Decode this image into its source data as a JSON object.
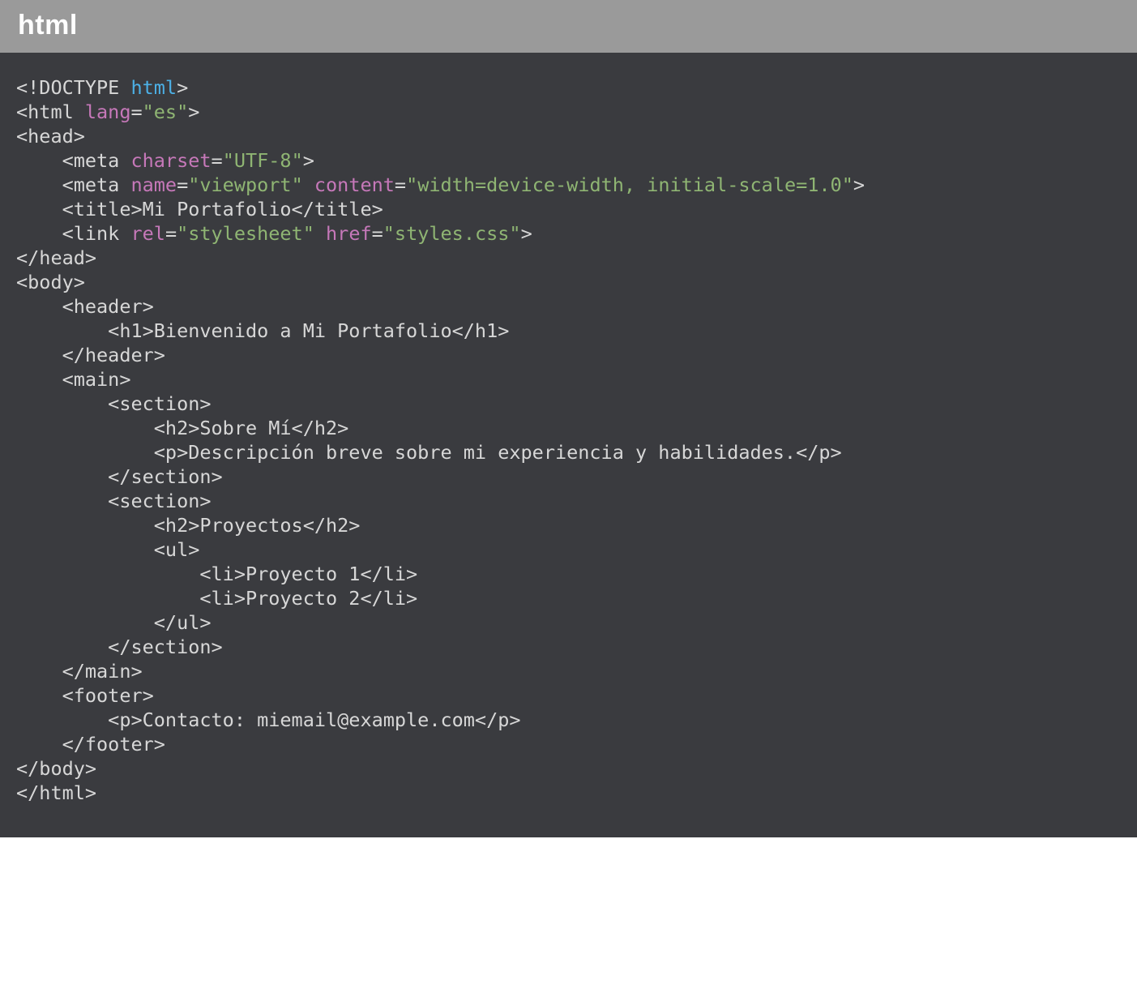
{
  "header": {
    "title": "html"
  },
  "tokens": {
    "l1_a": "<!DOCTYPE ",
    "l1_b": "html",
    "l1_c": ">",
    "l2_a": "<html ",
    "l2_b": "lang",
    "l2_c": "=",
    "l2_d": "\"es\"",
    "l2_e": ">",
    "l3": "<head>",
    "l4_a": "    <meta ",
    "l4_b": "charset",
    "l4_c": "=",
    "l4_d": "\"UTF-8\"",
    "l4_e": ">",
    "l5_a": "    <meta ",
    "l5_b": "name",
    "l5_c": "=",
    "l5_d": "\"viewport\"",
    "l5_e": " ",
    "l5_f": "content",
    "l5_g": "=",
    "l5_h": "\"width=device-width, initial-scale=1.0\"",
    "l5_i": ">",
    "l6": "    <title>Mi Portafolio</title>",
    "l7_a": "    <link ",
    "l7_b": "rel",
    "l7_c": "=",
    "l7_d": "\"stylesheet\"",
    "l7_e": " ",
    "l7_f": "href",
    "l7_g": "=",
    "l7_h": "\"styles.css\"",
    "l7_i": ">",
    "l8": "</head>",
    "l9": "<body>",
    "l10": "    <header>",
    "l11": "        <h1>Bienvenido a Mi Portafolio</h1>",
    "l12": "    </header>",
    "l13": "    <main>",
    "l14": "        <section>",
    "l15": "            <h2>Sobre Mí</h2>",
    "l16": "            <p>Descripción breve sobre mi experiencia y habilidades.</p>",
    "l17": "        </section>",
    "l18": "        <section>",
    "l19": "            <h2>Proyectos</h2>",
    "l20": "            <ul>",
    "l21": "                <li>Proyecto 1</li>",
    "l22": "                <li>Proyecto 2</li>",
    "l23": "            </ul>",
    "l24": "        </section>",
    "l25": "    </main>",
    "l26": "    <footer>",
    "l27": "        <p>Contacto: miemail@example.com</p>",
    "l28": "    </footer>",
    "l29": "</body>",
    "l30": "</html>"
  }
}
